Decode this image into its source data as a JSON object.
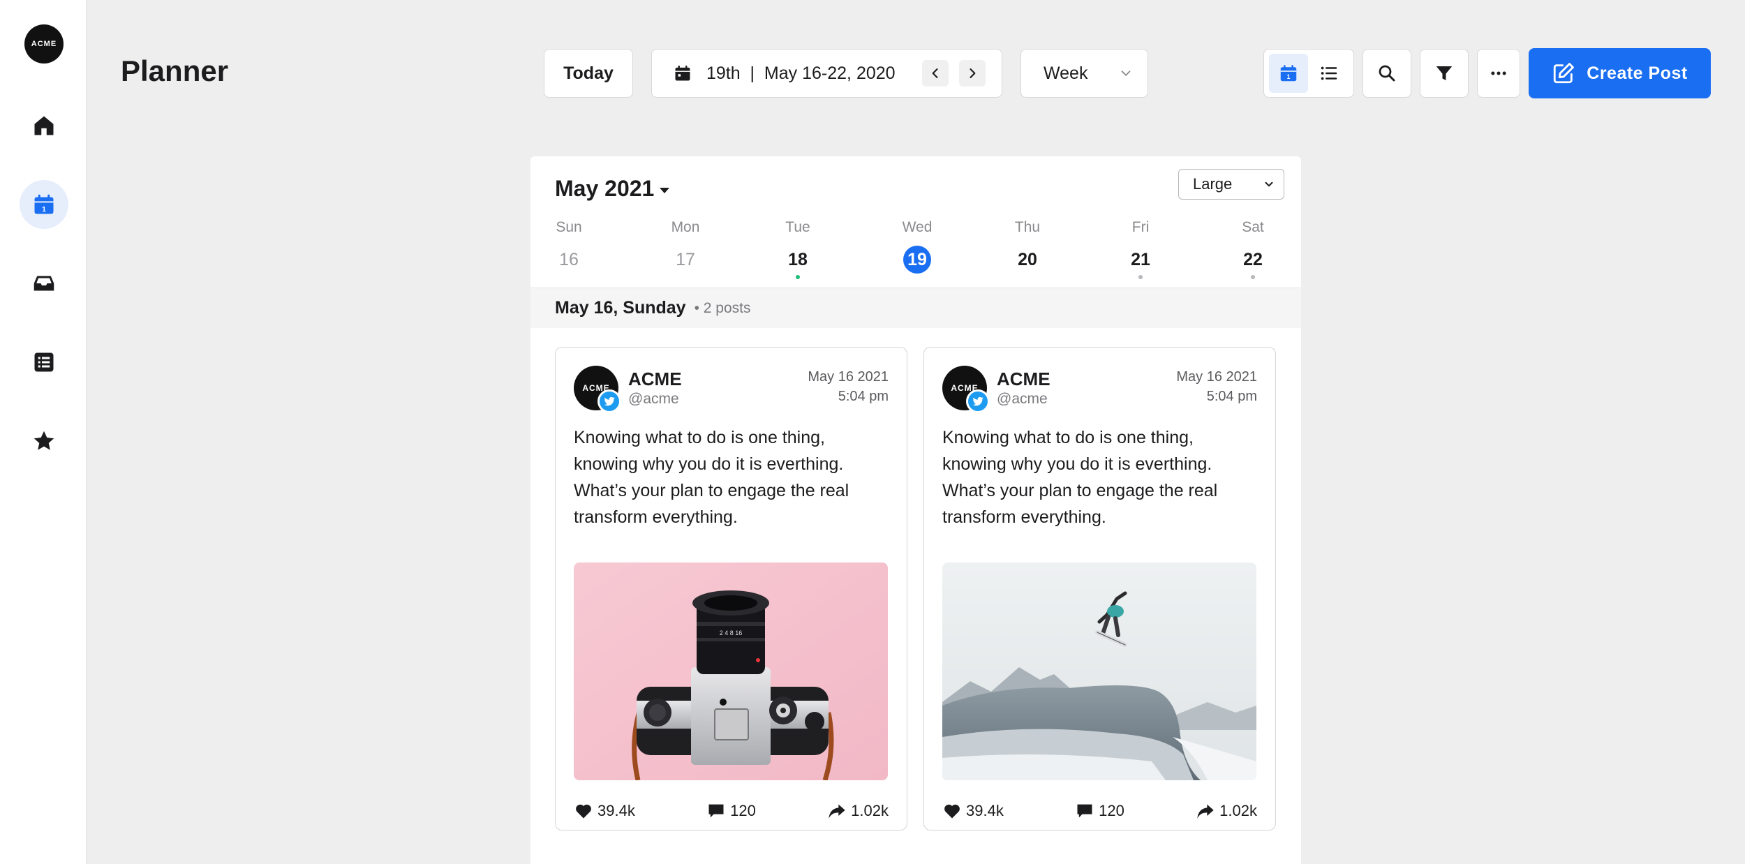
{
  "brand": {
    "logo_text": "ACME"
  },
  "sidebar": {
    "items": [
      {
        "icon": "home-icon",
        "active": false
      },
      {
        "icon": "calendar-icon",
        "active": true
      },
      {
        "icon": "inbox-icon",
        "active": false
      },
      {
        "icon": "list-icon",
        "active": false
      },
      {
        "icon": "star-icon",
        "active": false
      }
    ]
  },
  "header": {
    "title": "Planner",
    "today_label": "Today",
    "date_range": "19th  |  May 16-22, 2020",
    "view_select": "Week",
    "create_label": "Create Post"
  },
  "calendar": {
    "month_label": "May 2021",
    "size_select": "Large",
    "days": [
      {
        "name": "Sun",
        "num": "16",
        "state": "past",
        "dot": "none"
      },
      {
        "name": "Mon",
        "num": "17",
        "state": "past",
        "dot": "none"
      },
      {
        "name": "Tue",
        "num": "18",
        "state": "normal",
        "dot": "green"
      },
      {
        "name": "Wed",
        "num": "19",
        "state": "selected",
        "dot": "none"
      },
      {
        "name": "Thu",
        "num": "20",
        "state": "normal",
        "dot": "none"
      },
      {
        "name": "Fri",
        "num": "21",
        "state": "normal",
        "dot": "grey"
      },
      {
        "name": "Sat",
        "num": "22",
        "state": "normal",
        "dot": "grey"
      }
    ],
    "day_band": {
      "label": "May 16, Sunday",
      "count": "• 2 posts"
    }
  },
  "posts": [
    {
      "account": "ACME",
      "handle": "@acme",
      "avatar_text": "ACME",
      "date": "May 16 2021",
      "time": "5:04 pm",
      "text": "Knowing what to do is one thing, knowing why you do it is everthing. What’s your plan to engage the real transform everything.",
      "image": "camera-photo",
      "likes": "39.4k",
      "comments": "120",
      "shares": "1.02k"
    },
    {
      "account": "ACME",
      "handle": "@acme",
      "avatar_text": "ACME",
      "date": "May 16 2021",
      "time": "5:04 pm",
      "text": "Knowing what to do is one thing, knowing why you do it is everthing. What’s your plan to engage the real transform everything.",
      "image": "snowboarder-photo",
      "likes": "39.4k",
      "comments": "120",
      "shares": "1.02k"
    }
  ],
  "colors": {
    "accent": "#1a6ef2",
    "twitter": "#1d9bf0",
    "page_bg": "#eeeeee"
  }
}
